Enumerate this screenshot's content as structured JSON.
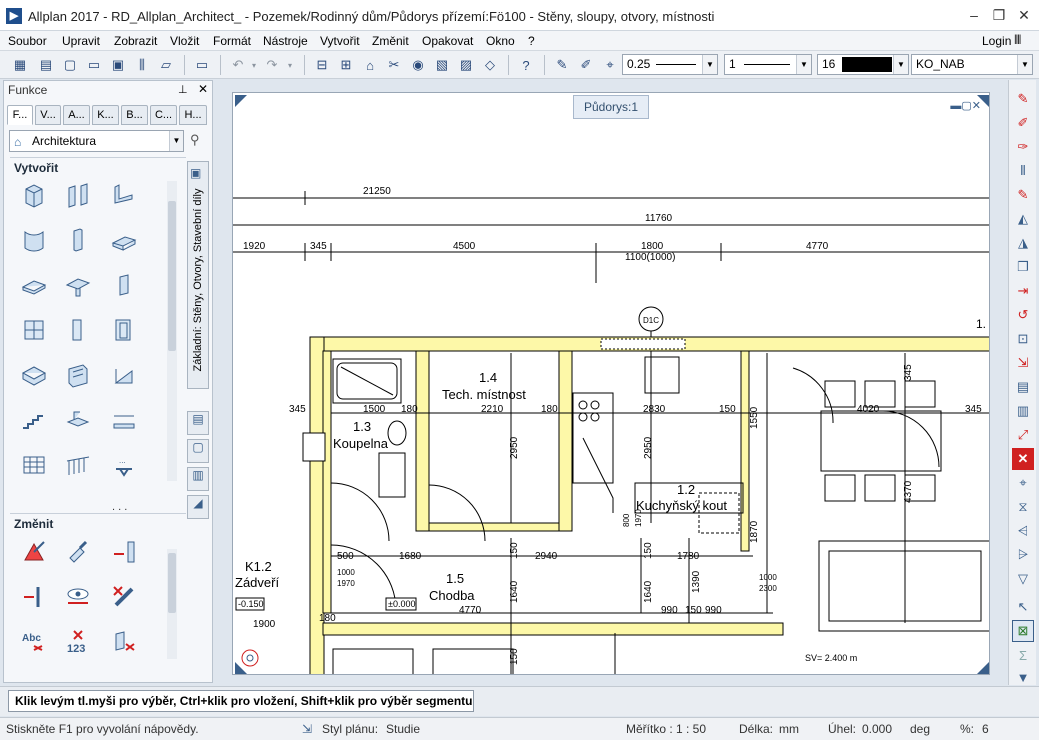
{
  "window": {
    "app": "Allplan 2017",
    "title": "Allplan 2017 - RD_Allplan_Architect_ - Pozemek/Rodinný dům/Půdorys přízemí:Fö100 - Stěny, sloupy, otvory, místnosti",
    "minimize": "–",
    "restore": "❐",
    "close": "✕"
  },
  "menu": {
    "items": [
      "Soubor",
      "Upravit",
      "Zobrazit",
      "Vložit",
      "Formát",
      "Nástroje",
      "Vytvořit",
      "Změnit",
      "Opakovat",
      "Okno",
      "?"
    ],
    "login": "Login"
  },
  "toolbar": {
    "pen_thickness": "0.25",
    "line_type": "1",
    "color_number": "16",
    "layer": "KO_NAB"
  },
  "panel": {
    "title": "Funkce",
    "pin": "ㅁ",
    "close": "✕",
    "tabs": [
      "F...",
      "V...",
      "A...",
      "K...",
      "B...",
      "C...",
      "H..."
    ],
    "category": "Architektura",
    "section_create": "Vytvořit",
    "section_modify": "Změnit",
    "vertical_tab": "Základní: Stěny, Otvory, Stavební díly"
  },
  "view": {
    "tab_label": "Půdorys:1"
  },
  "drawing": {
    "dims_top": [
      "21250",
      "11760",
      "1920",
      "345",
      "4500",
      "1800",
      "1100(1000)",
      "4770"
    ],
    "rooms": [
      {
        "num": "1.3",
        "name": "Koupelna"
      },
      {
        "num": "1.4",
        "name": "Tech. místnost"
      },
      {
        "num": "1.2",
        "name": "Kuchyňský kout"
      },
      {
        "num": "1.5",
        "name": "Chodba"
      },
      {
        "num": "K1.2",
        "name": "Zádveří"
      }
    ],
    "axis_label": "D1C",
    "corner_label": "1.",
    "dims_row2": [
      "345",
      "1500",
      "180",
      "2210",
      "180",
      "2830",
      "150",
      "4020",
      "345"
    ],
    "dims_row3": [
      "500",
      "1680",
      "2940",
      "1780"
    ],
    "dims_row4": [
      "4770",
      "990",
      "150",
      "990"
    ],
    "vertical_dims": [
      "2950",
      "2950",
      "1550",
      "1870",
      "1390",
      "1640",
      "1640",
      "4370",
      "345",
      "150",
      "150",
      "150",
      "1900",
      "180"
    ],
    "small_labels": [
      "1000",
      "1970",
      "1000",
      "2300",
      "800",
      "1970"
    ],
    "level_labels": [
      "-0.150",
      "±0.000"
    ],
    "sv_label": "SV= 2.400 m"
  },
  "hint": "Klik levým tl.myši pro výběr, Ctrl+klik pro vložení, Shift+klik pro výběr segmentu",
  "status": {
    "help": "Stiskněte F1 pro vyvolání nápovědy.",
    "plan_style_label": "Styl plánu:",
    "plan_style": "Studie",
    "scale_label": "Měřítko :",
    "scale": "1 : 50",
    "length_label": "Délka:",
    "length_unit": "mm",
    "angle_label": "Úhel:",
    "angle": "0.000",
    "angle_unit": "deg",
    "percent_label": "%:",
    "percent": "6"
  },
  "colors": {
    "wall_fill": "#fdf8a8",
    "wall_line": "#000000",
    "panel_bg": "#f5f7fa",
    "accent": "#1f4e8c",
    "tool_red": "#d02020"
  }
}
